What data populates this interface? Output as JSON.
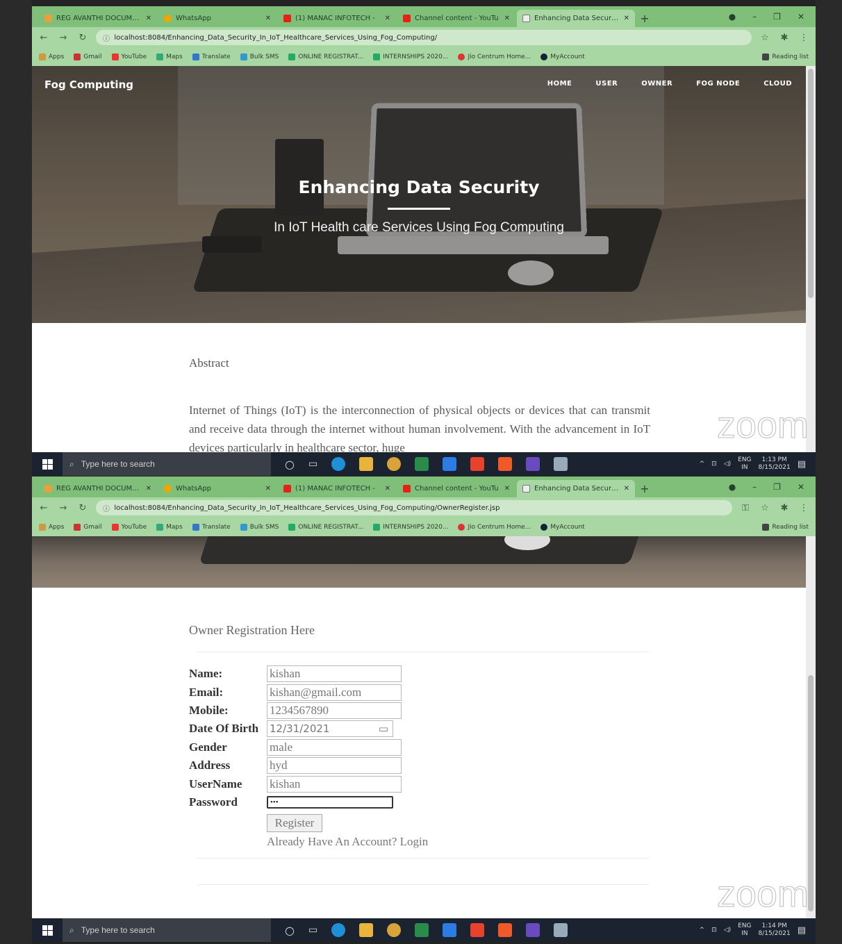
{
  "tabs": [
    {
      "title": "REG AVANTHI DOCUMEN",
      "color": "#e8a13a",
      "active": false
    },
    {
      "title": "WhatsApp",
      "color": "#f0a500",
      "active": false
    },
    {
      "title": "(1) MANAC INFOTECH -",
      "color": "#e62117",
      "active": false
    },
    {
      "title": "Channel content - YouTu",
      "color": "#e62117",
      "active": false
    },
    {
      "title": "Enhancing Data Security",
      "color": "#eaeaea",
      "active": true
    }
  ],
  "screens": [
    {
      "url": "localhost:8084/Enhancing_Data_Security_In_IoT_Healthcare_Services_Using_Fog_Computing/"
    },
    {
      "url": "localhost:8084/Enhancing_Data_Security_In_IoT_Healthcare_Services_Using_Fog_Computing/OwnerRegister.jsp"
    }
  ],
  "bookmarks": [
    "Apps",
    "Gmail",
    "YouTube",
    "Maps",
    "Translate",
    "Bulk SMS",
    "ONLINE REGISTRAT...",
    "INTERNSHIPS 2020...",
    "Jio Centrum Home...",
    "MyAccount"
  ],
  "bookmark_colors": [
    "#c94",
    "#c33",
    "#e33",
    "#3a7",
    "#37c",
    "#39c",
    "#2a6",
    "#2a6",
    "#d33",
    "#123"
  ],
  "reading_list": "Reading list",
  "site": {
    "brand": "Fog Computing",
    "menu": [
      "HOME",
      "USER",
      "OWNER",
      "FOG NODE",
      "CLOUD"
    ],
    "hero_title": "Enhancing Data Security",
    "hero_subtitle": "In IoT Health care Services Using Fog Computing",
    "abstract_heading": "Abstract",
    "abstract_text": "Internet of Things (IoT) is the interconnection of physical objects or devices that can transmit and receive data through the internet without human involvement. With the advancement in IoT devices particularly in healthcare sector, huge"
  },
  "registration": {
    "heading": "Owner Registration Here",
    "fields": [
      {
        "label": "Name:",
        "value": "kishan"
      },
      {
        "label": "Email:",
        "value": "kishan@gmail.com"
      },
      {
        "label": "Mobile:",
        "value": "1234567890"
      },
      {
        "label": "Date Of Birth",
        "value": "12/31/2021"
      },
      {
        "label": "Gender",
        "value": "male"
      },
      {
        "label": "Address",
        "value": "hyd"
      },
      {
        "label": "UserName",
        "value": "kishan"
      },
      {
        "label": "Password",
        "value": "•••"
      }
    ],
    "register_label": "Register",
    "login_text": "Already Have An Account? Login"
  },
  "taskbar": {
    "search_placeholder": "Type here to search",
    "lang": "ENG",
    "region": "IN",
    "times": [
      "1:13 PM",
      "1:14 PM"
    ],
    "date": "8/15/2021"
  },
  "zoom_watermark": "zoom"
}
